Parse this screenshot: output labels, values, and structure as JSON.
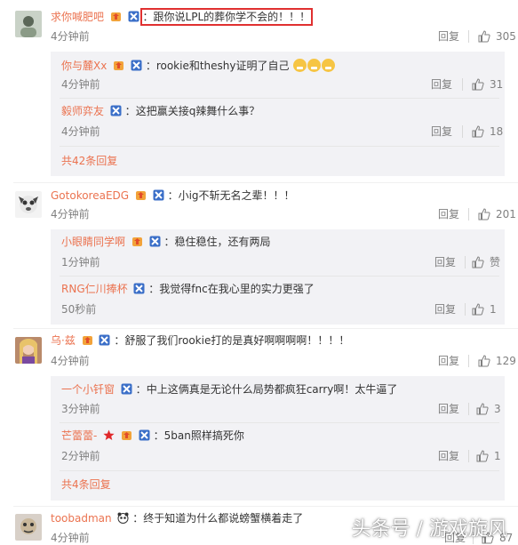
{
  "colors": {
    "username": "#eb7350",
    "meta": "#808080",
    "reply_bg": "#f2f2f5",
    "highlight": "#e03030"
  },
  "comments": [
    {
      "user": "求你喊肥吧",
      "text": "跟你说LPL的葬你学不会的！！！",
      "time": "4分钟前",
      "reply_label": "回复",
      "likes": "305",
      "replies": [
        {
          "user": "你与麓Xx",
          "text": "rookie和theshy证明了自己",
          "time": "4分钟前",
          "reply_label": "回复",
          "likes": "31"
        },
        {
          "user": "毅师弈友",
          "text": "这把赢关接q辣舞什么事？",
          "time": "4分钟前",
          "reply_label": "回复",
          "likes": "18"
        }
      ],
      "more": "共42条回复"
    },
    {
      "user": "GotokoreaEDG",
      "text": "小ig不斩无名之辈！！！",
      "time": "4分钟前",
      "reply_label": "回复",
      "likes": "201",
      "replies": [
        {
          "user": "小眼睛同学啊",
          "text": "稳住稳住，还有两局",
          "time": "1分钟前",
          "reply_label": "回复",
          "likes": "赞"
        },
        {
          "user": "RNG仁川捧杯",
          "text": "我觉得fnc在我心里的实力更强了",
          "time": "50秒前",
          "reply_label": "回复",
          "likes": "1"
        }
      ]
    },
    {
      "user": "乌·兹",
      "text": "舒服了我们rookie打的是真好啊啊啊啊！！！！",
      "time": "4分钟前",
      "reply_label": "回复",
      "likes": "129",
      "replies": [
        {
          "user": "一个小钎窗",
          "text": "中上这俩真是无论什么局势都疯狂carry啊！太牛逼了",
          "time": "3分钟前",
          "reply_label": "回复",
          "likes": "3"
        },
        {
          "user": "芒蕾蕾-",
          "text": "5ban照样搞死你",
          "time": "2分钟前",
          "reply_label": "回复",
          "likes": "1"
        }
      ],
      "more": "共4条回复"
    },
    {
      "user": "toobadman",
      "text": "终于知道为什么都说螃蟹横着走了",
      "time": "4分钟前",
      "reply_label": "回复",
      "likes": "87"
    }
  ],
  "colon": "：",
  "watermark": "头条号 / 游戏旋风"
}
